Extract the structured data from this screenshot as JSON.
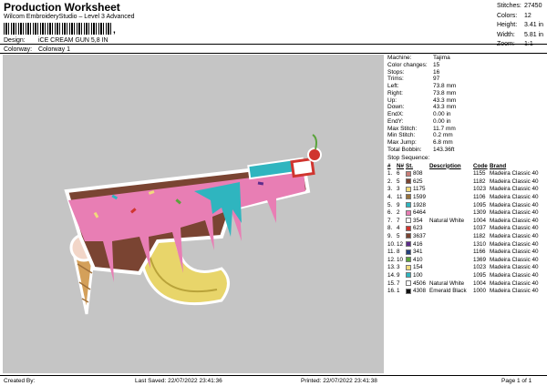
{
  "header": {
    "title": "Production Worksheet",
    "subtitle": "Wilcom EmbroideryStudio – Level 3 Advanced",
    "barcode_mark": ","
  },
  "design": {
    "design_label": "Design:",
    "design_value": "iCE CREAM GUN 5,8 IN",
    "colorway_label": "Colorway:",
    "colorway_value": "Colorway 1"
  },
  "stats": [
    {
      "k": "Stitches:",
      "v": "27450"
    },
    {
      "k": "Colors:",
      "v": "12"
    },
    {
      "k": "Height:",
      "v": "3.41 in"
    },
    {
      "k": "Width:",
      "v": "5.81 in"
    },
    {
      "k": "Zoom:",
      "v": "1:1"
    }
  ],
  "machine_info": [
    {
      "k": "Machine:",
      "v": "Tajima"
    },
    {
      "k": "Color changes:",
      "v": "15"
    },
    {
      "k": "Stops:",
      "v": "16"
    },
    {
      "k": "Trims:",
      "v": "97"
    },
    {
      "k": "Left:",
      "v": "73.8 mm"
    },
    {
      "k": "Right:",
      "v": "73.8 mm"
    },
    {
      "k": "Up:",
      "v": "43.3 mm"
    },
    {
      "k": "Down:",
      "v": "43.3 mm"
    },
    {
      "k": "EndX:",
      "v": "0.00 in"
    },
    {
      "k": "EndY:",
      "v": "0.00 in"
    },
    {
      "k": "Max Stitch:",
      "v": "11.7 mm"
    },
    {
      "k": "Min Stitch:",
      "v": "0.2 mm"
    },
    {
      "k": "Max Jump:",
      "v": "6.8 mm"
    },
    {
      "k": "Total Bobbin:",
      "v": "143.36ft"
    }
  ],
  "sequence": {
    "title": "Stop Sequence:",
    "headers": {
      "num": "#",
      "n": "N#",
      "st": "St.",
      "desc": "Description",
      "code": "Code",
      "brand": "Brand"
    },
    "rows": [
      {
        "num": "1.",
        "n": "6",
        "color": "#c97e78",
        "st": "808",
        "desc": "",
        "code": "1155",
        "brand": "Madeira Classic 40"
      },
      {
        "num": "2.",
        "n": "5",
        "color": "#7a4432",
        "st": "625",
        "desc": "",
        "code": "1182",
        "brand": "Madeira Classic 40"
      },
      {
        "num": "3.",
        "n": "3",
        "color": "#f1da7c",
        "st": "1175",
        "desc": "",
        "code": "1023",
        "brand": "Madeira Classic 40"
      },
      {
        "num": "4.",
        "n": "11",
        "color": "#98723c",
        "st": "1599",
        "desc": "",
        "code": "1106",
        "brand": "Madeira Classic 40"
      },
      {
        "num": "5.",
        "n": "9",
        "color": "#2fb5bf",
        "st": "1928",
        "desc": "",
        "code": "1095",
        "brand": "Madeira Classic 40"
      },
      {
        "num": "6.",
        "n": "2",
        "color": "#e87eb4",
        "st": "6464",
        "desc": "",
        "code": "1309",
        "brand": "Madeira Classic 40"
      },
      {
        "num": "7.",
        "n": "7",
        "color": "#ffffff",
        "st": "354",
        "desc": "Natural White",
        "code": "1004",
        "brand": "Madeira Classic 40"
      },
      {
        "num": "8.",
        "n": "4",
        "color": "#d0352f",
        "st": "623",
        "desc": "",
        "code": "1037",
        "brand": "Madeira Classic 40"
      },
      {
        "num": "9.",
        "n": "5",
        "color": "#7a4432",
        "st": "3637",
        "desc": "",
        "code": "1182",
        "brand": "Madeira Classic 40"
      },
      {
        "num": "10.",
        "n": "12",
        "color": "#5e2d8c",
        "st": "416",
        "desc": "",
        "code": "1310",
        "brand": "Madeira Classic 40"
      },
      {
        "num": "11.",
        "n": "8",
        "color": "#24407e",
        "st": "341",
        "desc": "",
        "code": "1166",
        "brand": "Madeira Classic 40"
      },
      {
        "num": "12.",
        "n": "10",
        "color": "#5aa33c",
        "st": "410",
        "desc": "",
        "code": "1369",
        "brand": "Madeira Classic 40"
      },
      {
        "num": "13.",
        "n": "3",
        "color": "#f1da7c",
        "st": "154",
        "desc": "",
        "code": "1023",
        "brand": "Madeira Classic 40"
      },
      {
        "num": "14.",
        "n": "9",
        "color": "#2fb5bf",
        "st": "100",
        "desc": "",
        "code": "1095",
        "brand": "Madeira Classic 40"
      },
      {
        "num": "15.",
        "n": "7",
        "color": "#ffffff",
        "st": "4506",
        "desc": "Natural White",
        "code": "1004",
        "brand": "Madeira Classic 40"
      },
      {
        "num": "16.",
        "n": "1",
        "color": "#111111",
        "st": "4308",
        "desc": "Emerald Black",
        "code": "1000",
        "brand": "Madeira Classic 40"
      }
    ]
  },
  "footer": {
    "created": "Created By:",
    "saved": "Last Saved: 22/07/2022 23:41:36",
    "printed": "Printed: 22/07/2022 23:41:38",
    "page": "Page 1 of 1"
  }
}
